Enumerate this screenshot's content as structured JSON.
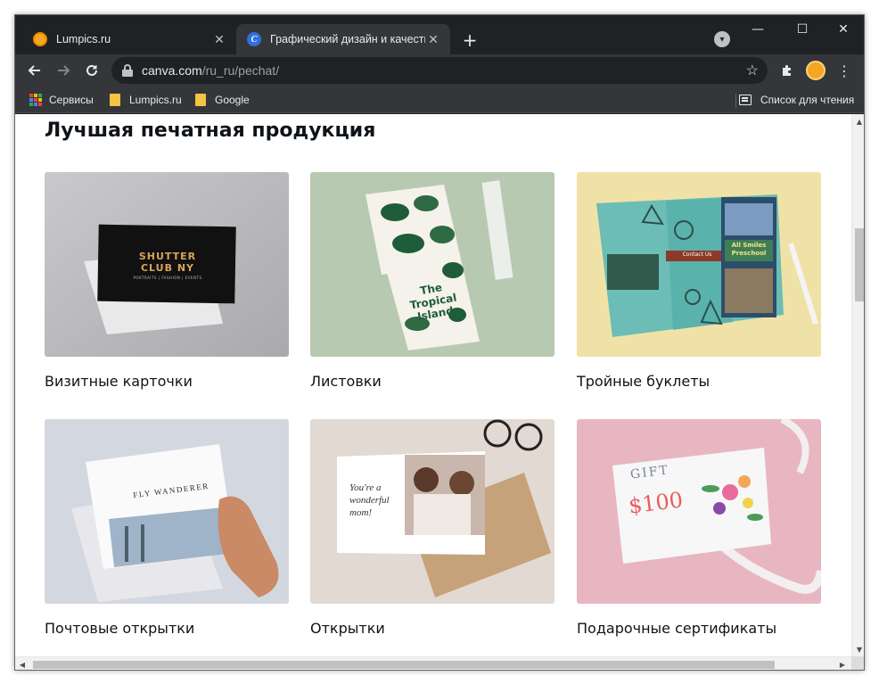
{
  "tabs": [
    {
      "title": "Lumpics.ru",
      "favicon": "lumpics-orange-icon"
    },
    {
      "title": "Графический дизайн и качеств",
      "favicon": "canva-icon",
      "favicon_letter": "C"
    }
  ],
  "tab_close_glyph": "✕",
  "new_tab_glyph": "+",
  "window_controls": {
    "minimize": "—",
    "maximize": "☐",
    "close": "✕"
  },
  "address": {
    "host": "canva.com",
    "path": "/ru_ru/pechat/"
  },
  "bookmarks": {
    "apps_label": "Сервисы",
    "items": [
      "Lumpics.ru",
      "Google"
    ],
    "reading_list": "Список для чтения"
  },
  "page": {
    "heading": "Лучшая печатная продукция",
    "cards": [
      {
        "label": "Визитные карточки",
        "image": "business-card-mockup",
        "image_text": "SHUTTER CLUB NY",
        "image_sub": "PORTRAITS | FASHION | EVENTS"
      },
      {
        "label": "Листовки",
        "image": "tropical-flyer-mockup",
        "image_text": "The Tropical Island"
      },
      {
        "label": "Тройные буклеты",
        "image": "trifold-brochure-mockup",
        "image_text": "All Smiles Preschool",
        "image_text2": "Contact Us"
      },
      {
        "label": "Почтовые открытки",
        "image": "postcard-mockup",
        "image_text": "FLY WANDERER"
      },
      {
        "label": "Открытки",
        "image": "greeting-card-mockup",
        "image_text": "You're a wonderful mom!"
      },
      {
        "label": "Подарочные сертификаты",
        "image": "gift-certificate-mockup",
        "image_text": "GIFT",
        "image_text2": "$100"
      }
    ]
  },
  "colors": {
    "chrome_dark": "#202124",
    "chrome_toolbar": "#35363a",
    "text_dark": "#0e1318"
  }
}
